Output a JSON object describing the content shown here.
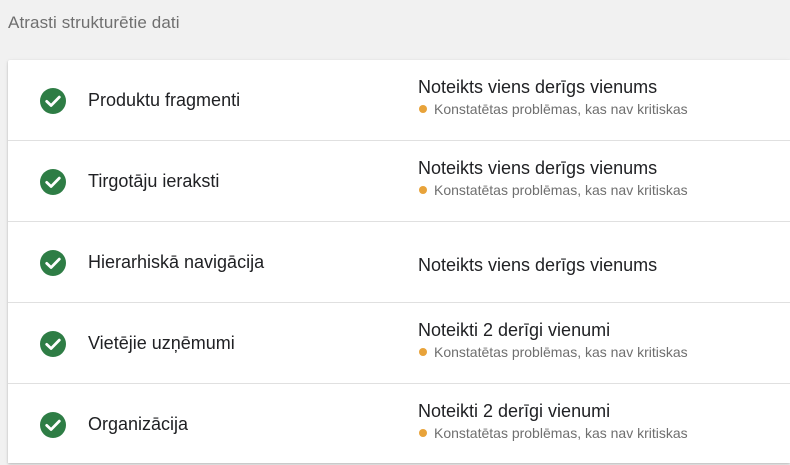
{
  "section_title": "Atrasti strukturētie dati",
  "colors": {
    "check": "#2e7d45",
    "warning_dot": "#e8a33a"
  },
  "rows": [
    {
      "label": "Produktu fragmenti",
      "status": "Noteikts viens derīgs vienums",
      "note": "Konstatētas problēmas, kas nav kritiskas"
    },
    {
      "label": "Tirgotāju ieraksti",
      "status": "Noteikts viens derīgs vienums",
      "note": "Konstatētas problēmas, kas nav kritiskas"
    },
    {
      "label": "Hierarhiskā navigācija",
      "status": "Noteikts viens derīgs vienums",
      "note": ""
    },
    {
      "label": "Vietējie uzņēmumi",
      "status": "Noteikti 2 derīgi vienumi",
      "note": "Konstatētas problēmas, kas nav kritiskas"
    },
    {
      "label": "Organizācija",
      "status": "Noteikti 2 derīgi vienumi",
      "note": "Konstatētas problēmas, kas nav kritiskas"
    }
  ]
}
